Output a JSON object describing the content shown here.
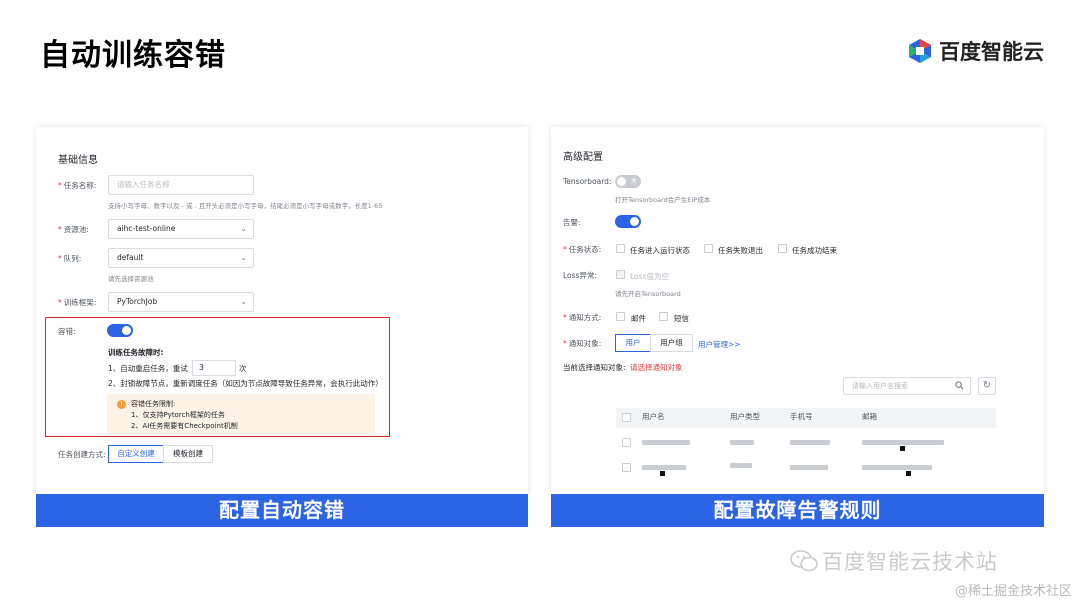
{
  "slide": {
    "title": "自动训练容错",
    "brand": "百度智能云",
    "captions": {
      "left": "配置自动容错",
      "right": "配置故障告警规则"
    },
    "watermarks": {
      "line1": "百度智能云技术站",
      "line2": "@稀土掘金技术社区"
    }
  },
  "colors": {
    "accent": "#2c64e6",
    "highlight_border": "#e02424",
    "warning_bg": "#fdf3e4",
    "required": "#e0393e"
  },
  "left_panel": {
    "section_title": "基础信息",
    "task_name": {
      "label": "任务名称:",
      "placeholder": "请输入任务名称",
      "hint": "支持小写字母、数字以及 - 或 . 且开头必须是小写字母，结尾必须是小写字母或数字，长度1-65"
    },
    "resource_pool": {
      "label": "资源池:",
      "value": "aihc-test-online"
    },
    "queue": {
      "label": "队列:",
      "value": "default",
      "hint": "请先选择资源池"
    },
    "framework": {
      "label": "训练框架:",
      "value": "PyTorchJob"
    },
    "fault_tolerance": {
      "label": "容错:",
      "enabled": true,
      "heading": "训练任务故障时:",
      "item1_prefix": "1、自动重启任务，重试",
      "retry_count": "3",
      "item1_suffix": "次",
      "item2": "2、封锁故障节点，重新调度任务（如因为节点故障导致任务异常，会执行此动作）",
      "limits_title": "容错任务限制:",
      "limit1": "1、仅支持Pytorch框架的任务",
      "limit2": "2、AI任务需要有Checkpoint机制"
    },
    "create_method": {
      "label": "任务创建方式:",
      "options": [
        "自定义创建",
        "模板创建"
      ],
      "selected": "自定义创建"
    }
  },
  "right_panel": {
    "section_title": "高级配置",
    "tensorboard": {
      "label": "Tensorboard:",
      "toggle_text": "关",
      "hint": "打开Tensorboard会产生EIP成本"
    },
    "alert": {
      "label": "告警:",
      "enabled": true
    },
    "task_status": {
      "label": "任务状态:",
      "options": [
        "任务进入运行状态",
        "任务失败退出",
        "任务成功结束"
      ]
    },
    "loss_anomaly": {
      "label": "Loss异常:",
      "option": "Loss值为空",
      "hint": "请先开启Tensorboard"
    },
    "notify_method": {
      "label": "通知方式:",
      "options": [
        "邮件",
        "短信"
      ]
    },
    "notify_target": {
      "label": "通知对象:",
      "tabs": [
        "用户",
        "用户组"
      ],
      "selected": "用户",
      "manage_link": "用户管理>>"
    },
    "current_selection": {
      "label": "当前选择通知对象:",
      "value": "请选择通知对象"
    },
    "search": {
      "placeholder": "请输入用户名搜索"
    },
    "table": {
      "headers": [
        "用户名",
        "用户类型",
        "手机号",
        "邮箱"
      ]
    }
  }
}
